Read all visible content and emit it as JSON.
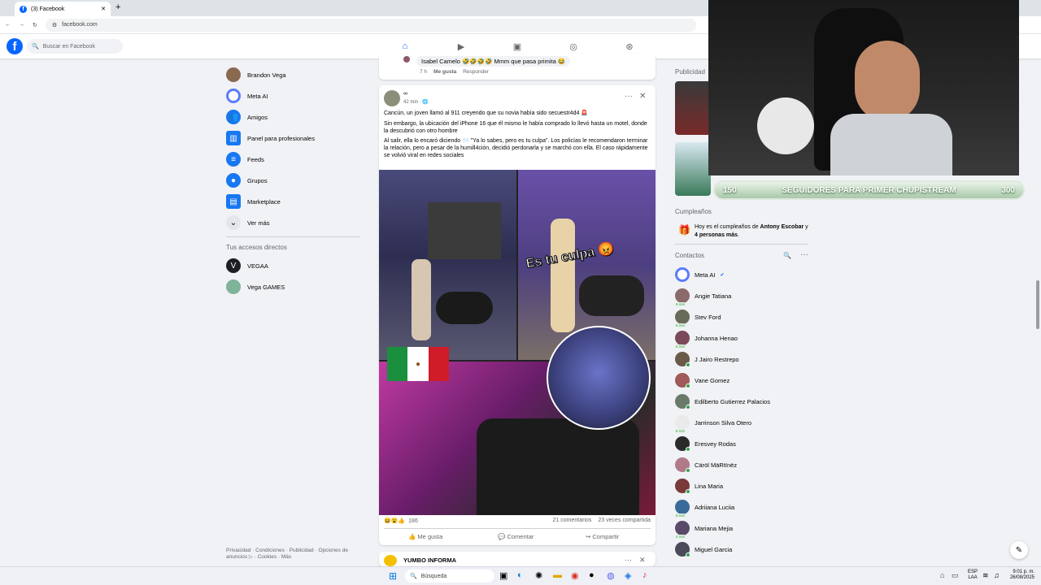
{
  "browser": {
    "tab_title": "(3) Facebook",
    "url": "facebook.com"
  },
  "header": {
    "search_placeholder": "Buscar en Facebook",
    "nav": [
      "home-icon",
      "video-icon",
      "marketplace-icon",
      "groups-icon",
      "gaming-icon"
    ]
  },
  "left_nav": {
    "items": [
      "Brandon Vega",
      "Meta AI",
      "Amigos",
      "Panel para profesionales",
      "Feeds",
      "Grupos",
      "Marketplace",
      "Ver más"
    ],
    "shortcuts_title": "Tus accesos directos",
    "shortcuts": [
      "VEGAA",
      "Vega GAMES"
    ],
    "footer": "Privacidad · Condiciones · Publicidad · Opciones de anuncios ▷ · Cookies · Más"
  },
  "comment": {
    "author": "Isabel Camelo",
    "text": "Mmm que pasa primita 😂",
    "time": "7 h",
    "like": "Me gusta",
    "reply": "Responder"
  },
  "post": {
    "author": "∞",
    "time": "42 min · 🌐",
    "p1": "Cancún, un joven llamó al 911 creyendo que su novia había sido secuestr4d4 🚨",
    "p2": "Sin embargo, la ubicación del iPhone 16 que él mismo le había comprado lo llevó hasta un motel, donde la descubrió con otro hombre",
    "p3": "Al salir, ella lo encaró diciendo 📨 \"Ya lo sabes, pero es tu culpa\". Los policías le recomendaron terminar la relación, pero a pesar de la humill4ción, decidió perdonarla y se marchó con ella. El caso rápidamente se volvió viral en redes sociales",
    "overlay": "Es tu culpa 😡",
    "reactions": "186",
    "comments": "21 comentarios",
    "shares": "23 veces compartida",
    "like": "Me gusta",
    "comment": "Comentar",
    "share": "Compartir"
  },
  "next_post": {
    "author": "YUMBO INFORMA"
  },
  "right": {
    "ads_title": "Publicidad",
    "birthdays_title": "Cumpleaños",
    "birthday_pre": "Hoy es el cumpleaños de ",
    "birthday_name": "Antony Escobar",
    "birthday_mid": " y ",
    "birthday_others": "4 personas más",
    "birthday_end": ".",
    "contacts_title": "Contactos",
    "contacts": [
      {
        "name": "Meta AI",
        "badge": ""
      },
      {
        "name": "Angie Tatiana",
        "badge": "6 min"
      },
      {
        "name": "Stev Ford",
        "badge": "6 min"
      },
      {
        "name": "Johanna Henao",
        "badge": "6 min"
      },
      {
        "name": "J Jairo Restrepo",
        "badge": ""
      },
      {
        "name": "Vane Gomez",
        "badge": ""
      },
      {
        "name": "Edilberto Gutierrez Palacios",
        "badge": ""
      },
      {
        "name": "Jarrinson Silva Otero",
        "badge": "6 min"
      },
      {
        "name": "Eresvey Rodas",
        "badge": ""
      },
      {
        "name": "Cäröl MäRtïnëz",
        "badge": ""
      },
      {
        "name": "Lina Maria",
        "badge": ""
      },
      {
        "name": "Adriiana Luciia",
        "badge": "5 min"
      },
      {
        "name": "Mariana Mejia",
        "badge": "4 min"
      },
      {
        "name": "Miguel Garcia",
        "badge": ""
      }
    ]
  },
  "stream": {
    "left": "150",
    "label": "SEGUIDORES PARA PRIMER CHUPISTREAM",
    "right": "300",
    "progress": 0
  },
  "taskbar": {
    "search": "Búsqueda",
    "lang1": "ESP",
    "lang2": "LAA",
    "time": "9:01 p. m.",
    "date": "26/08/2025"
  },
  "colors": {
    "accent": "#0866ff",
    "bg": "#f0f2f5",
    "online": "#31a24c"
  }
}
